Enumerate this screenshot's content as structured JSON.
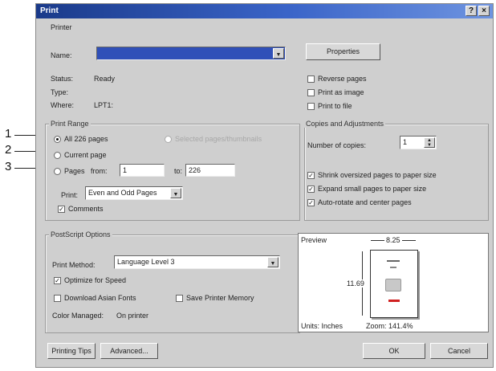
{
  "window": {
    "title": "Print",
    "help_btn": "?",
    "close_btn": "×"
  },
  "callouts": [
    "1",
    "2",
    "3"
  ],
  "printer": {
    "group_label": "Printer",
    "name_label": "Name:",
    "name_value": "",
    "properties_label": "Properties",
    "status_label": "Status:",
    "status_value": "Ready",
    "type_label": "Type:",
    "type_value": "",
    "where_label": "Where:",
    "where_value": "LPT1:",
    "reverse_pages": "Reverse pages",
    "print_as_image": "Print as image",
    "print_to_file": "Print to file"
  },
  "print_range": {
    "group_label": "Print Range",
    "all_pages": "All 226 pages",
    "selected_pages": "Selected pages/thumbnails",
    "current_page": "Current page",
    "pages_label": "Pages",
    "from_label": "from:",
    "from_value": "1",
    "to_label": "to:",
    "to_value": "226",
    "print_label": "Print:",
    "print_value": "Even and Odd Pages",
    "comments": "Comments"
  },
  "copies": {
    "group_label": "Copies and Adjustments",
    "number_label": "Number of copies:",
    "number_value": "1",
    "shrink": "Shrink oversized pages to paper size",
    "expand": "Expand small pages to paper size",
    "autorotate": "Auto-rotate and center pages"
  },
  "postscript": {
    "group_label": "PostScript Options",
    "method_label": "Print Method:",
    "method_value": "Language Level 3",
    "optimize": "Optimize for Speed",
    "download_fonts": "Download Asian Fonts",
    "save_memory": "Save Printer Memory",
    "color_label": "Color Managed:",
    "color_value": "On printer"
  },
  "preview": {
    "label": "Preview",
    "width": "8.25",
    "height": "11.69",
    "units": "Units: Inches",
    "zoom": "Zoom: 141.4%"
  },
  "buttons": {
    "printing_tips": "Printing Tips",
    "advanced": "Advanced...",
    "ok": "OK",
    "cancel": "Cancel"
  }
}
